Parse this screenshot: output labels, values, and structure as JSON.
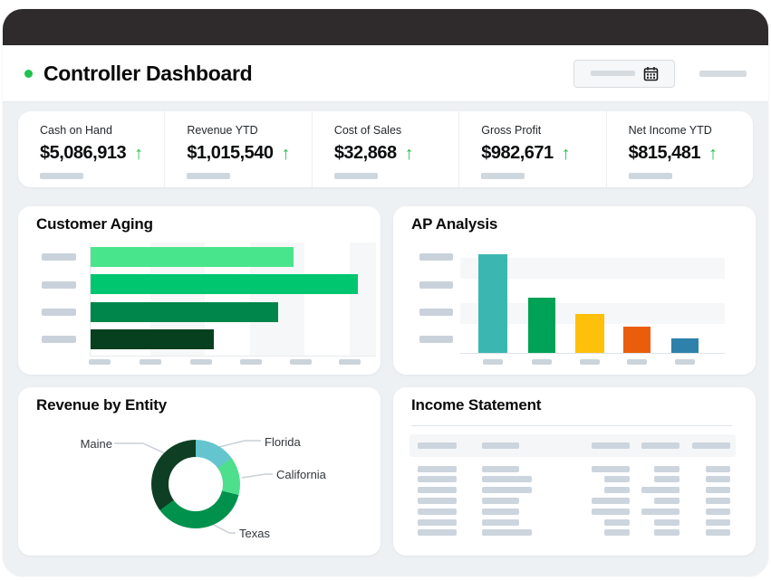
{
  "header": {
    "title": "Controller Dashboard",
    "status_dot_color": "#1ec24f",
    "date_picker": {
      "value_redacted": true,
      "icon": "calendar-icon"
    },
    "right_control_redacted": true
  },
  "icons": {
    "up_arrow": "↑",
    "calendar": "calendar-grid-glyph"
  },
  "colors": {
    "topbar": "#2f2b2c",
    "page_bg": "#edf1f4",
    "accent_green": "#1ec24f",
    "placeholder_pill": "#ccd5dd",
    "card_bg": "#ffffff"
  },
  "kpis": [
    {
      "label": "Cash on Hand",
      "value": "$5,086,913",
      "trend": "up"
    },
    {
      "label": "Revenue YTD",
      "value": "$1,015,540",
      "trend": "up"
    },
    {
      "label": "Cost of Sales",
      "value": "$32,868",
      "trend": "up"
    },
    {
      "label": "Gross Profit",
      "value": "$982,671",
      "trend": "up"
    },
    {
      "label": "Net Income YTD",
      "value": "$815,481",
      "trend": "up"
    }
  ],
  "cards": {
    "customer_aging": {
      "title": "Customer Aging"
    },
    "ap_analysis": {
      "title": "AP Analysis"
    },
    "revenue_by_entity": {
      "title": "Revenue by Entity"
    },
    "income_statement": {
      "title": "Income Statement"
    }
  },
  "chart_data": [
    {
      "type": "bar",
      "orientation": "horizontal",
      "title": "Customer Aging",
      "categories": [
        "redacted",
        "redacted",
        "redacted",
        "redacted"
      ],
      "values_pct_of_max": [
        76,
        100,
        70,
        46
      ],
      "colors": [
        "#49e58c",
        "#00c670",
        "#00864a",
        "#06401f"
      ],
      "axis_tick_labels": "redacted-gray-placeholder-bars",
      "x_tick_count": 6,
      "grid": "vertical-stripes",
      "legend": "none"
    },
    {
      "type": "bar",
      "orientation": "vertical",
      "title": "AP Analysis",
      "categories": [
        "redacted",
        "redacted",
        "redacted",
        "redacted",
        "redacted"
      ],
      "values_pct_of_max": [
        100,
        56,
        39,
        27,
        15
      ],
      "colors": [
        "#3ab7b1",
        "#00a256",
        "#fec00b",
        "#e95d0d",
        "#2e81ab"
      ],
      "axis_tick_labels": "redacted-gray-placeholder-bars",
      "grid": "horizontal-stripes",
      "legend": "none"
    },
    {
      "type": "pie",
      "subtype": "donut",
      "title": "Revenue by Entity",
      "slices": [
        {
          "label": "Florida",
          "pct": 15,
          "color": "#64c5ce"
        },
        {
          "label": "California",
          "pct": 14,
          "color": "#4ddf8b"
        },
        {
          "label": "Texas",
          "pct": 36,
          "color": "#00914d"
        },
        {
          "label": "Maine",
          "pct": 35,
          "color": "#0e3e24"
        }
      ],
      "start_angle_deg": 0,
      "direction": "clockwise",
      "labels_style": "outside-with-leader-lines",
      "legend": "none"
    },
    {
      "type": "table",
      "title": "Income Statement",
      "columns": 5,
      "rows": 7,
      "cells_redacted": true,
      "column_align": [
        "left",
        "left",
        "right",
        "right",
        "right"
      ],
      "header_pill_widths": [
        43,
        41,
        42,
        42,
        42
      ],
      "row_pill_widths": [
        [
          43,
          41,
          42,
          28,
          27
        ],
        [
          43,
          55,
          28,
          28,
          27
        ],
        [
          43,
          55,
          28,
          42,
          27
        ],
        [
          43,
          41,
          42,
          28,
          27
        ],
        [
          43,
          41,
          42,
          42,
          27
        ],
        [
          43,
          41,
          28,
          28,
          27
        ],
        [
          43,
          55,
          28,
          28,
          27
        ]
      ]
    }
  ]
}
